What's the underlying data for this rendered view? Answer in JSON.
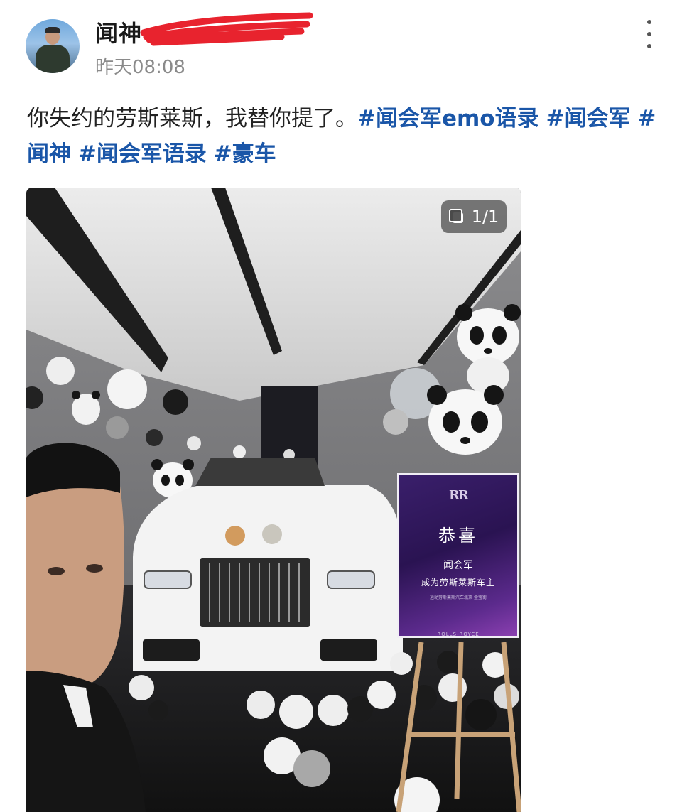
{
  "post": {
    "author": {
      "name": "闻神",
      "time": "昨天08:08"
    },
    "text": {
      "plain": "你失约的劳斯莱斯，我替你提了。",
      "hashtags": [
        "#闻会军emo语录",
        "#闻会军",
        "#闻神",
        "#闻会军语录",
        "#豪车"
      ]
    },
    "image": {
      "counter": "1/1",
      "sign": {
        "logo": "RR",
        "line1": "恭喜",
        "line2": "闻会军",
        "line3": "成为劳斯莱斯车主",
        "line4": "运动劳斯莱斯汽车北京·金宝街",
        "brand": "ROLLS-ROYCE"
      }
    }
  },
  "icons": {
    "more": "more-vertical-icon",
    "counter": "image-stack-icon"
  },
  "colors": {
    "hashtag": "#1a56a8",
    "redaction": "#e8232e",
    "timestamp": "#8a8a8a"
  }
}
